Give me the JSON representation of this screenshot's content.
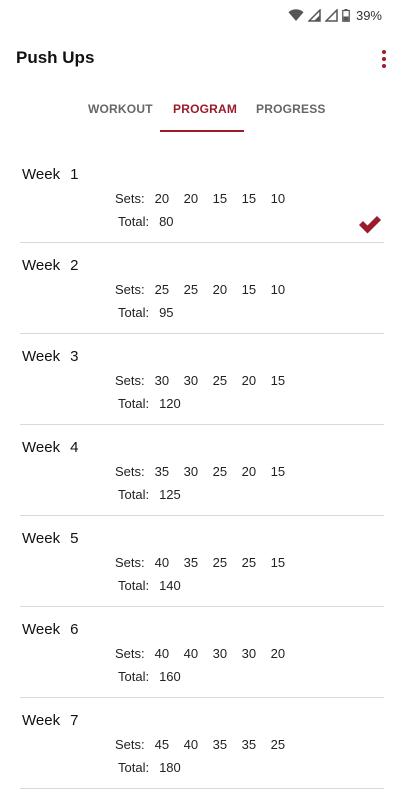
{
  "status_bar": {
    "battery_percent": "39%",
    "icons": [
      "wifi-icon",
      "signal-icon",
      "signal-icon",
      "battery-icon"
    ]
  },
  "app_bar": {
    "title": "Push Ups",
    "menu_icon": "overflow-menu-icon"
  },
  "tabs": [
    {
      "label": "WORKOUT",
      "active": false
    },
    {
      "label": "PROGRAM",
      "active": true
    },
    {
      "label": "PROGRESS",
      "active": false
    }
  ],
  "program": {
    "week_word": "Week",
    "sets_label": "Sets:",
    "total_label": "Total:",
    "weeks": [
      {
        "number": "1",
        "sets": [
          "20",
          "20",
          "15",
          "15",
          "10"
        ],
        "total": "80",
        "completed": true
      },
      {
        "number": "2",
        "sets": [
          "25",
          "25",
          "20",
          "15",
          "10"
        ],
        "total": "95",
        "completed": false
      },
      {
        "number": "3",
        "sets": [
          "30",
          "30",
          "25",
          "20",
          "15"
        ],
        "total": "120",
        "completed": false
      },
      {
        "number": "4",
        "sets": [
          "35",
          "30",
          "25",
          "20",
          "15"
        ],
        "total": "125",
        "completed": false
      },
      {
        "number": "5",
        "sets": [
          "40",
          "35",
          "25",
          "25",
          "15"
        ],
        "total": "140",
        "completed": false
      },
      {
        "number": "6",
        "sets": [
          "40",
          "40",
          "30",
          "30",
          "20"
        ],
        "total": "160",
        "completed": false
      },
      {
        "number": "7",
        "sets": [
          "45",
          "40",
          "35",
          "35",
          "25"
        ],
        "total": "180",
        "completed": false
      }
    ]
  },
  "colors": {
    "accent": "#9b1b2a",
    "divider": "#d9d9d9",
    "inactive_tab": "#666666"
  }
}
